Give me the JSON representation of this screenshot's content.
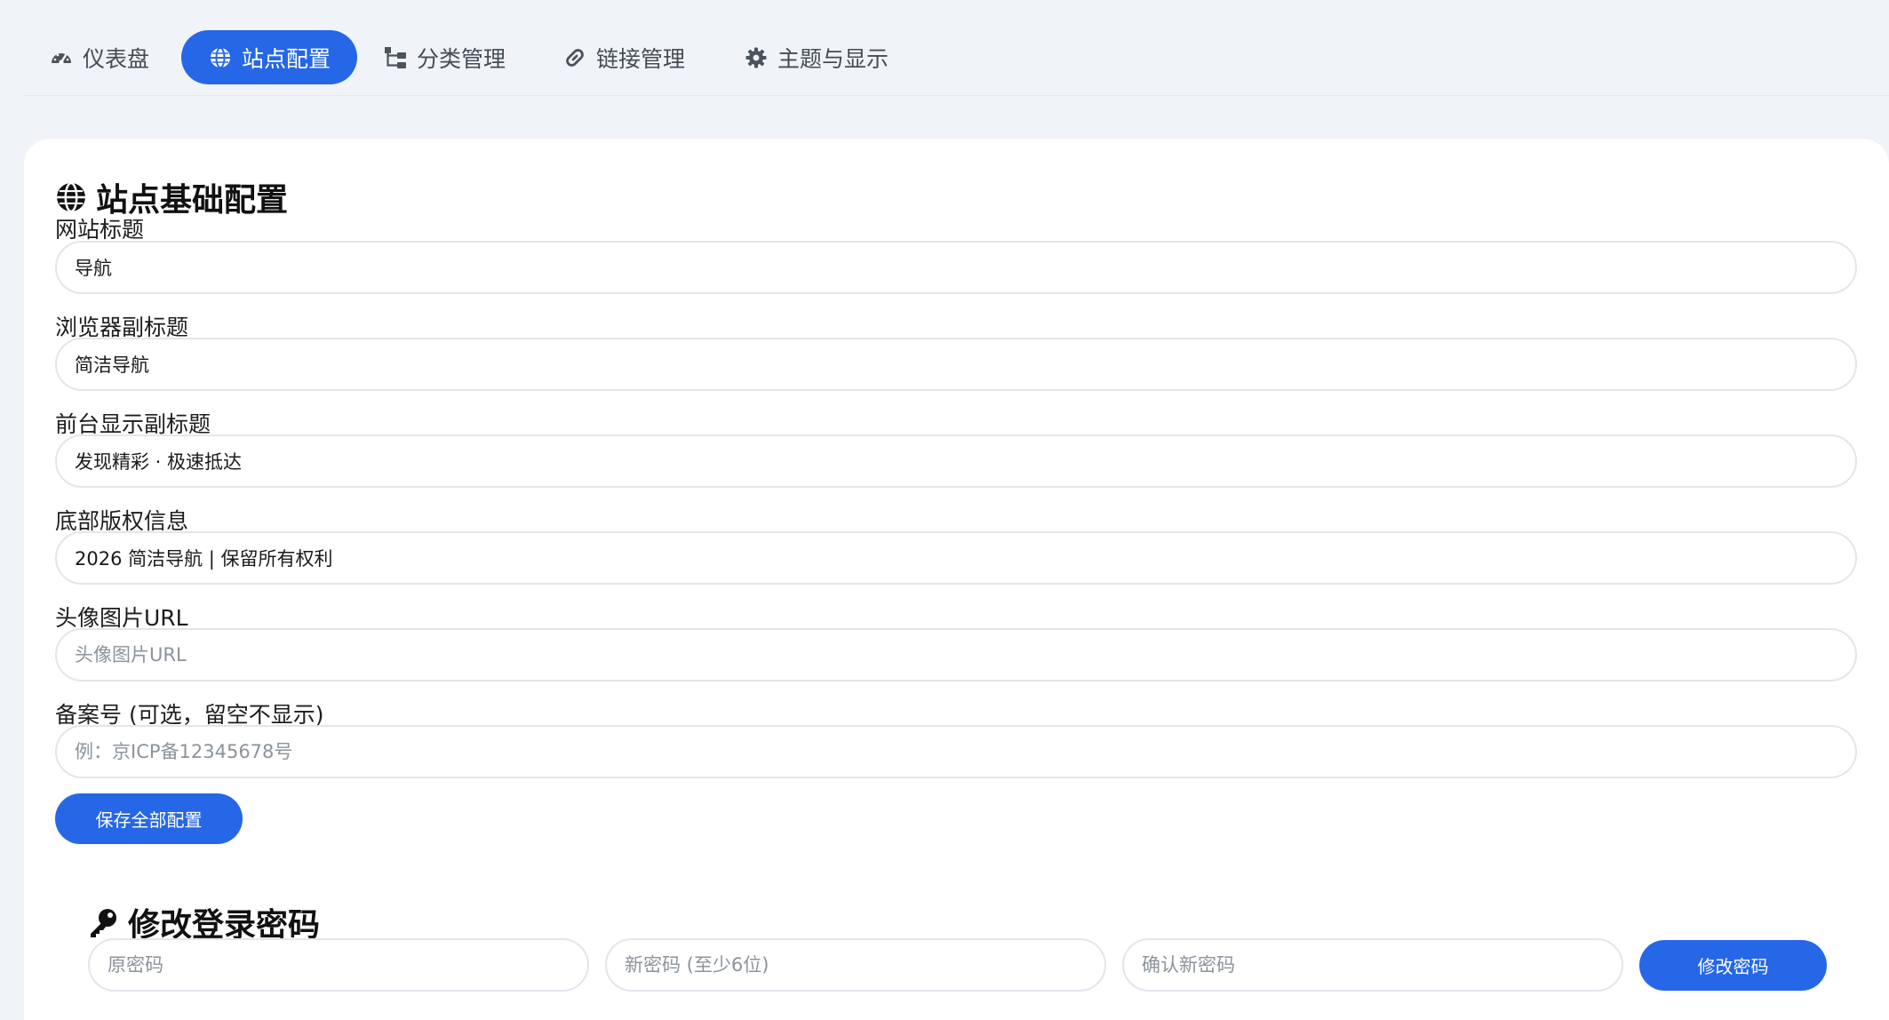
{
  "nav": {
    "tabs": [
      {
        "label": "仪表盘",
        "icon": "dashboard-icon",
        "active": false
      },
      {
        "label": "站点配置",
        "icon": "globe-icon",
        "active": true
      },
      {
        "label": "分类管理",
        "icon": "sitemap-icon",
        "active": false
      },
      {
        "label": "链接管理",
        "icon": "link-icon",
        "active": false
      },
      {
        "label": "主题与显示",
        "icon": "gear-icon",
        "active": false
      }
    ]
  },
  "site_config": {
    "title": "站点基础配置",
    "fields": [
      {
        "label": "网站标题",
        "value": "导航",
        "placeholder": ""
      },
      {
        "label": "浏览器副标题",
        "value": "简洁导航",
        "placeholder": ""
      },
      {
        "label": "前台显示副标题",
        "value": "发现精彩 · 极速抵达",
        "placeholder": ""
      },
      {
        "label": "底部版权信息",
        "value": "2026 简洁导航 | 保留所有权利",
        "placeholder": ""
      },
      {
        "label": "头像图片URL",
        "value": "",
        "placeholder": "头像图片URL"
      },
      {
        "label": "备案号 (可选，留空不显示)",
        "value": "",
        "placeholder": "例：京ICP备12345678号"
      }
    ],
    "save_label": "保存全部配置"
  },
  "password": {
    "title": "修改登录密码",
    "old_placeholder": "原密码",
    "new_placeholder": "新密码 (至少6位)",
    "confirm_placeholder": "确认新密码",
    "submit_label": "修改密码"
  },
  "colors": {
    "accent": "#2567e6",
    "background": "#f0f4f8",
    "card": "#ffffff",
    "border": "#e2e6ec"
  }
}
